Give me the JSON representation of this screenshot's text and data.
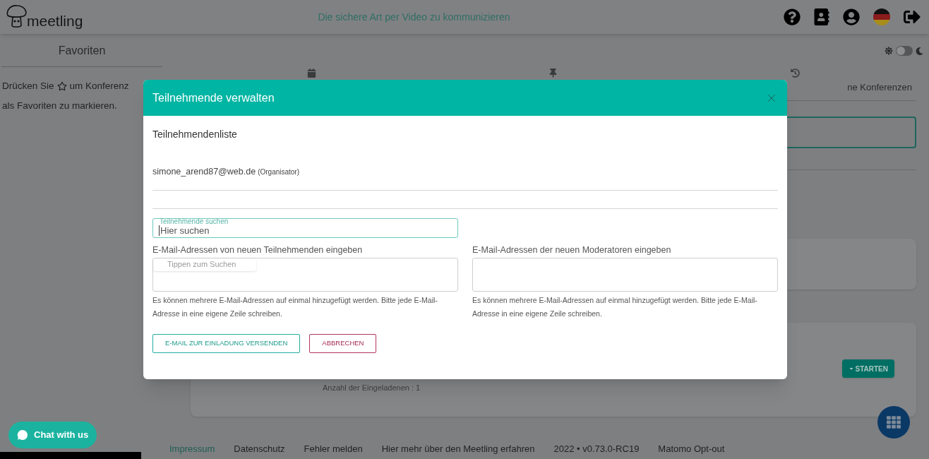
{
  "header": {
    "logo": "meetling",
    "tagline": "Die sichere Art per Video zu kommunizieren"
  },
  "sidebar": {
    "title": "Favoriten",
    "hint_start": "Drücken Sie",
    "hint_end": "um Konferenz",
    "hint_line2": "als Favoriten zu markieren."
  },
  "theme": {
    "dark_mode": false
  },
  "tabs": [
    {
      "kind": "calendar"
    },
    {
      "kind": "pin"
    },
    {
      "kind": "history",
      "label": "ne Konferenzen"
    }
  ],
  "cards": [
    {
      "kind": "empty"
    },
    {
      "kind": "conference",
      "invited": "Anzahl der Eingeladenen : 1",
      "button": "STARTEN"
    }
  ],
  "footer": [
    {
      "label": "Impressum",
      "selected": true
    },
    {
      "label": "Datenschutz",
      "selected": false
    },
    {
      "label": "Fehler melden",
      "selected": false
    },
    {
      "label": "Hier mehr über den Meetling erfahren",
      "selected": false
    },
    {
      "label": "2022 • v0.73.0-RC19",
      "selected": false
    },
    {
      "label": "Matomo Opt-out",
      "selected": false
    }
  ],
  "chat_button": "Chat with us",
  "dialog": {
    "title": "Teilnehmende verwalten",
    "list_title": "Teilnehmendenliste",
    "participants": [
      {
        "email": "simone_arend87@web.de",
        "role": "(Organisator)"
      }
    ],
    "search": {
      "label": "Teilnehmende suchen",
      "placeholder": "Hier suchen",
      "suggestion": "Tippen zum Suchen"
    },
    "fields": [
      {
        "label": "E-Mail-Adressen von neuen Teilnehmenden eingeben",
        "hint": "Es können mehrere E-Mail-Adressen auf einmal hinzugefügt werden. Bitte jede E-Mail-Adresse in eine eigene Zeile schreiben."
      },
      {
        "label": "E-Mail-Adressen der neuen Moderatoren eingeben",
        "hint": "Es können mehrere E-Mail-Adressen auf einmal hinzugefügt werden. Bitte jede E-Mail-Adresse in eine eigene Zeile schreiben."
      }
    ],
    "buttons": [
      {
        "label": "E-MAIL ZUR EINLADUNG VERSENDEN",
        "kind": "primary"
      },
      {
        "label": "ABBRECHEN",
        "kind": "danger"
      }
    ]
  }
}
